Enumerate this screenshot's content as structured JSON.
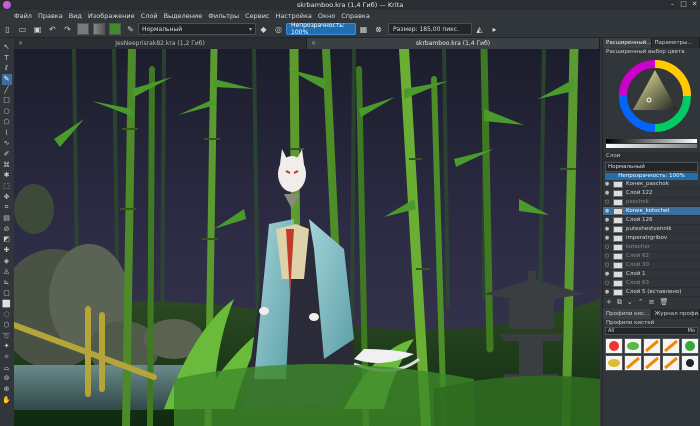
{
  "window": {
    "title": "skrbamboo.kra (1,4 Гиб)  — Krita"
  },
  "menu": [
    "Файл",
    "Правка",
    "Вид",
    "Изображение",
    "Слой",
    "Выделение",
    "Фильтры",
    "Сервис",
    "Настройка",
    "Окно",
    "Справка"
  ],
  "toolbar": {
    "blend_mode": "Нормальный",
    "opacity_label": "Непрозрачность: 100%",
    "size_label": "Размер: 185,00 пикс.",
    "fg_color": "#7a7a7a",
    "bg_color": "#3d8c2a"
  },
  "tabs": [
    {
      "label": "JesNeeprisrak82.kra (1,2 Гиб)",
      "active": false
    },
    {
      "label": "skrbamboo.kra (1,4 Гиб)",
      "active": true
    }
  ],
  "right_panel": {
    "top_tabs": [
      "Расширенный...",
      "Параметры..."
    ],
    "color_title": "Расширенный выбор цвета",
    "layers_title": "Слои",
    "layers_blend": "Нормальный",
    "layers_opacity": "Непрозрачность:  100%",
    "layers": [
      {
        "name": "Kонек_paschok",
        "visible": true,
        "selected": false,
        "dim": false
      },
      {
        "name": "Слой 122",
        "visible": true,
        "selected": false,
        "dim": false
      },
      {
        "name": "paschok",
        "visible": false,
        "selected": false,
        "dim": true
      },
      {
        "name": "Koneк_kotochet",
        "visible": true,
        "selected": true,
        "dim": false
      },
      {
        "name": "Слой 126",
        "visible": true,
        "selected": false,
        "dim": false
      },
      {
        "name": "putеshestvennik",
        "visible": true,
        "selected": false,
        "dim": false
      },
      {
        "name": "imperatrgribov",
        "visible": true,
        "selected": false,
        "dim": false
      },
      {
        "name": "kotocher",
        "visible": false,
        "selected": false,
        "dim": true
      },
      {
        "name": "Слой 62",
        "visible": false,
        "selected": false,
        "dim": true
      },
      {
        "name": "Слой 30",
        "visible": false,
        "selected": false,
        "dim": true
      },
      {
        "name": "Слой 1",
        "visible": true,
        "selected": false,
        "dim": false
      },
      {
        "name": "Слой 63",
        "visible": false,
        "selected": false,
        "dim": true
      },
      {
        "name": "Слой 5 (вставлено)",
        "visible": true,
        "selected": false,
        "dim": false
      }
    ],
    "brush_tabs": [
      "Профили кис...",
      "Журнал профилей..."
    ],
    "brush_title": "Профили кистей",
    "brush_filter": "All",
    "brush_tag": "Mo"
  }
}
